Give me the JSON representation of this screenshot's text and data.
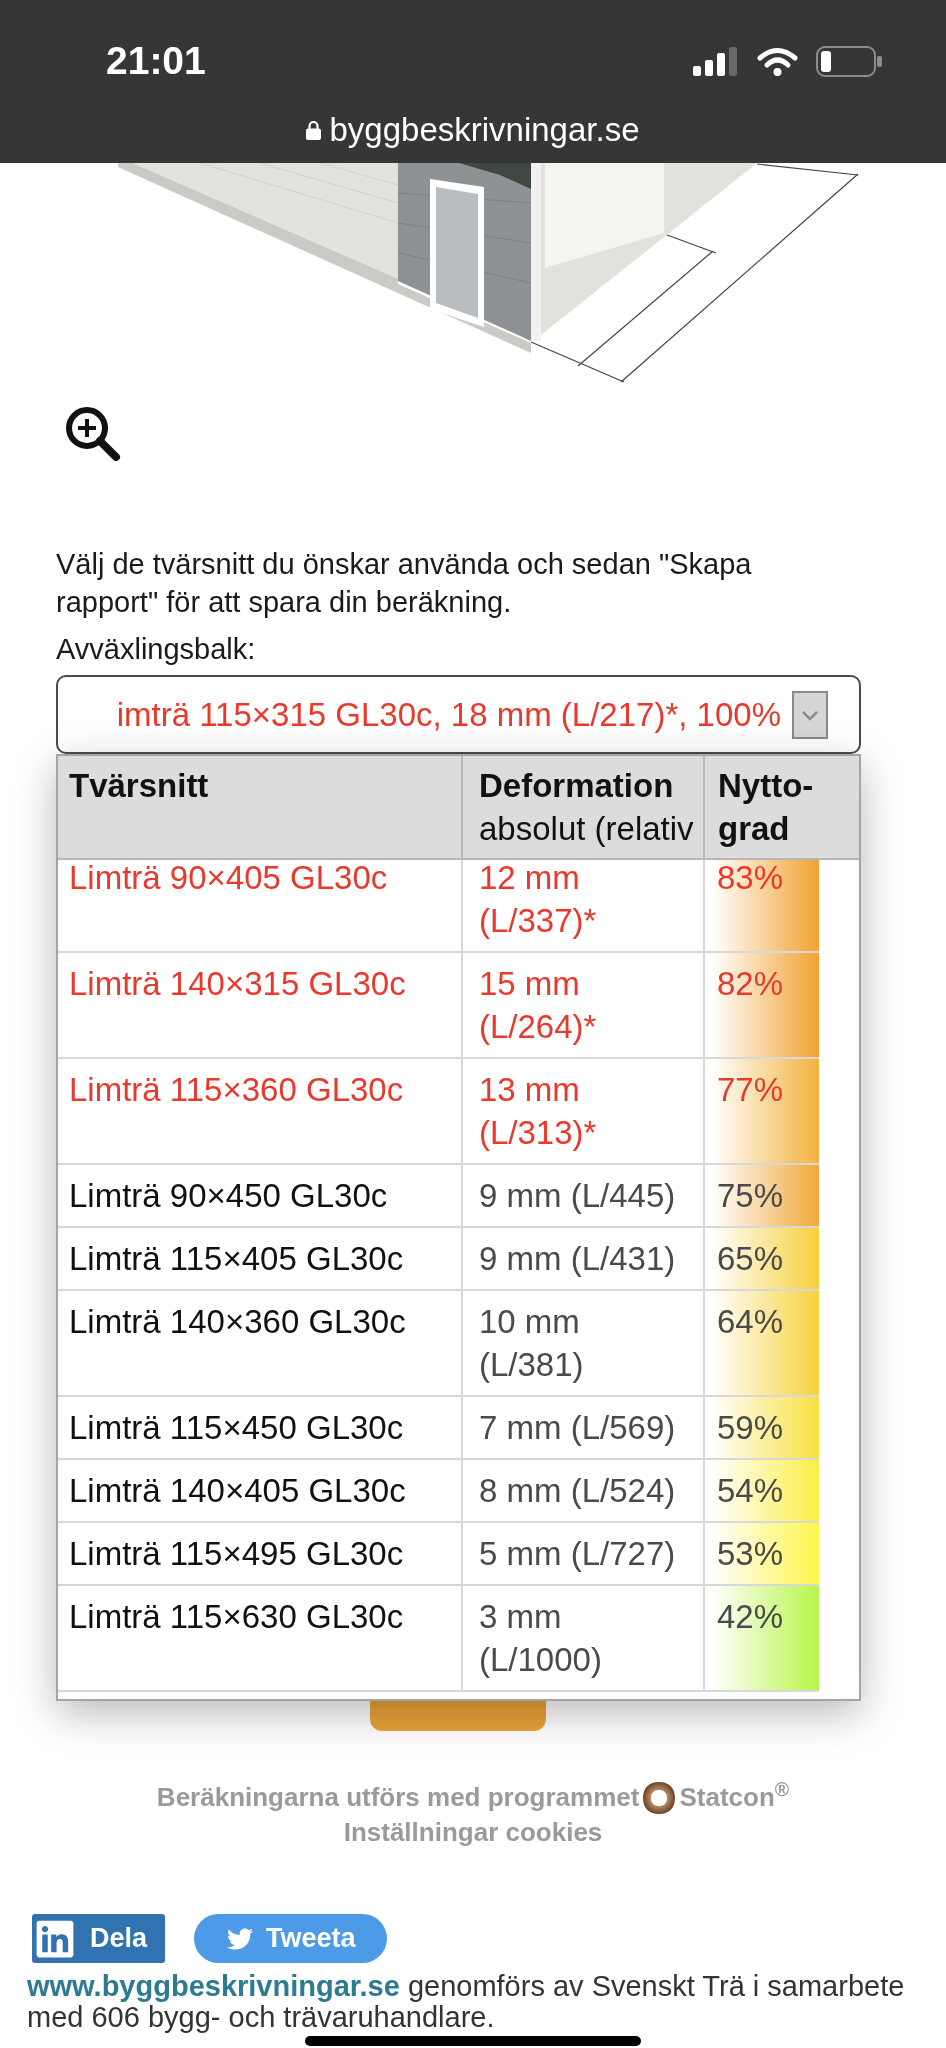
{
  "status_bar": {
    "time": "21:01",
    "url": "byggbeskrivningar.se"
  },
  "intro": "Välj de tvärsnitt du önskar använda och sedan \"Skapa rapport\" för att spara din beräkning.",
  "select": {
    "label": "Avväxlingsbalk:",
    "value": "imträ 115×315 GL30c, 18 mm (L/217)*, 100%",
    "over_limit": true,
    "expanded": true
  },
  "dropdown": {
    "columns": [
      {
        "title": "Tvärsnitt"
      },
      {
        "title": "Deformation",
        "subtitle": "absolut (relativ"
      },
      {
        "title": "Nytto-grad"
      }
    ],
    "rows": [
      {
        "section": "Limträ 90×405 GL30c",
        "deformation": "12 mm (L/337)*",
        "utilization": "83%",
        "over_limit": true,
        "selected": false,
        "color": "#f0a232"
      },
      {
        "section": "Limträ 140×315 GL30c",
        "deformation": "15 mm (L/264)*",
        "utilization": "82%",
        "over_limit": true,
        "selected": false,
        "color": "#f0a232"
      },
      {
        "section": "Limträ 115×360 GL30c",
        "deformation": "13 mm (L/313)*",
        "utilization": "77%",
        "over_limit": true,
        "selected": false,
        "color": "#f2b23c"
      },
      {
        "section": "Limträ 90×450 GL30c",
        "deformation": "9 mm (L/445)",
        "utilization": "75%",
        "over_limit": false,
        "selected": false,
        "color": "#f0a83a"
      },
      {
        "section": "Limträ 115×405 GL30c",
        "deformation": "9 mm (L/431)",
        "utilization": "65%",
        "over_limit": false,
        "selected": false,
        "color": "#f6d03a"
      },
      {
        "section": "Limträ 140×360 GL30c",
        "deformation": "10 mm (L/381)",
        "utilization": "64%",
        "over_limit": false,
        "selected": false,
        "color": "#f6d23c"
      },
      {
        "section": "Limträ 115×450 GL30c",
        "deformation": "7 mm (L/569)",
        "utilization": "59%",
        "over_limit": false,
        "selected": false,
        "color": "#f8e03e"
      },
      {
        "section": "Limträ 140×405 GL30c",
        "deformation": "8 mm (L/524)",
        "utilization": "54%",
        "over_limit": false,
        "selected": false,
        "color": "#fbee44"
      },
      {
        "section": "Limträ 115×495 GL30c",
        "deformation": "5 mm (L/727)",
        "utilization": "53%",
        "over_limit": false,
        "selected": false,
        "color": "#fdf64a"
      },
      {
        "section": "Limträ 115×630 GL30c",
        "deformation": "3 mm (L/1000)",
        "utilization": "42%",
        "over_limit": false,
        "selected": false,
        "color": "#b8f548"
      }
    ]
  },
  "footer": {
    "credit": "Beräkningarna utförs med programmet",
    "brand": "Statcon$^{®}$",
    "cookies": "Inställningar cookies",
    "share_buttons": [
      {
        "kind": "linkedin",
        "label": "Dela"
      },
      {
        "kind": "twitter",
        "label": "Tweeta"
      }
    ],
    "about": {
      "link": "www.byggbeskrivningar.se",
      "text": "genomförs av Svenskt Trä i samarbete med 606 bygg- och trävaruhandlare."
    }
  }
}
